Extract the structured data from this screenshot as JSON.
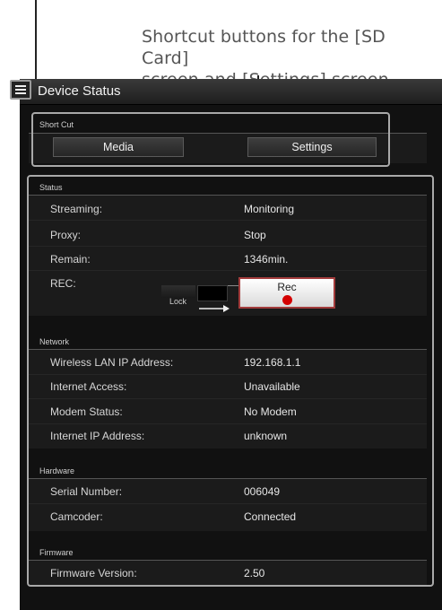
{
  "callout": {
    "line1": "Shortcut buttons for the [SD Card]",
    "line2": "screen and [Settings] screen"
  },
  "header": {
    "title": "Device Status",
    "menu_icon": "hamburger-menu-icon"
  },
  "shortcut": {
    "section_label": "Short Cut",
    "media_label": "Media",
    "settings_label": "Settings"
  },
  "status": {
    "section_label": "Status",
    "rows": [
      {
        "label": "Streaming:",
        "value": "Monitoring"
      },
      {
        "label": "Proxy:",
        "value": "Stop"
      },
      {
        "label": "Remain:",
        "value": "1346min."
      },
      {
        "label": "REC:",
        "value": ""
      }
    ],
    "lock_label": "Lock",
    "rec_label": "Rec",
    "rec_color": "#d40000"
  },
  "network": {
    "section_label": "Network",
    "rows": [
      {
        "label": "Wireless LAN IP Address:",
        "value": "192.168.1.1"
      },
      {
        "label": "Internet Access:",
        "value": "Unavailable"
      },
      {
        "label": "Modem Status:",
        "value": "No Modem"
      },
      {
        "label": "Internet IP Address:",
        "value": "unknown"
      }
    ]
  },
  "hardware": {
    "section_label": "Hardware",
    "rows": [
      {
        "label": "Serial Number:",
        "value": "006049"
      },
      {
        "label": "Camcoder:",
        "value": "Connected"
      }
    ]
  },
  "firmware": {
    "section_label": "Firmware",
    "rows": [
      {
        "label": "Firmware Version:",
        "value": "2.50"
      }
    ]
  }
}
